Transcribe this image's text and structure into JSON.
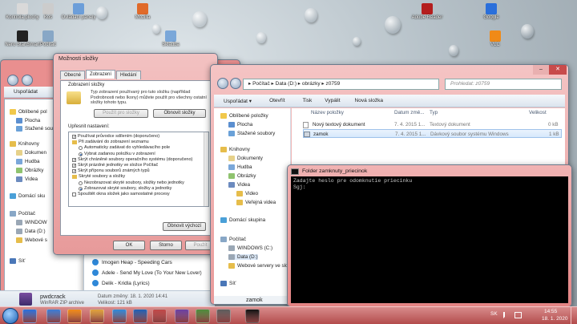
{
  "desktop": {
    "icons": [
      {
        "label": "Kontrola\nplochy",
        "color": "#d9d9d9"
      },
      {
        "label": "Koš",
        "color": "#cccccc"
      },
      {
        "label": "Ovládací\npanely",
        "color": "#6c9ed9"
      },
      {
        "label": "Mozilla",
        "color": "#e06a2a"
      },
      {
        "label": "Adobe Reader",
        "color": "#b41e1e"
      },
      {
        "label": "Google",
        "color": "#2a6fdb"
      },
      {
        "label": "Nero\nStartSmart",
        "color": "#222222"
      },
      {
        "label": "Počítač",
        "color": "#88a7c6"
      },
      {
        "label": "Skladba",
        "color": "#7aa7d9"
      },
      {
        "label": "VLC",
        "color": "#f08a17"
      }
    ]
  },
  "left_explorer": {
    "organize_label": "Uspořádat",
    "nav": {
      "favorites": "Oblíbené pol",
      "desktop": "Plocha",
      "downloads": "Stažené sou",
      "libraries": "Knihovny",
      "documents": "Dokumen",
      "music": "Hudba",
      "pictures": "Obrázky",
      "videos": "Videa",
      "homegroup": "Domácí sku",
      "computer": "Počítač",
      "windows": "WINDOW",
      "data": "Data (D:)",
      "web": "Webové s",
      "network": "Síť"
    },
    "details": {
      "name": "pwdcrack",
      "type": "WinRAR ZIP archive",
      "modified": "Datum změny: 18. 1. 2020 14:41",
      "size": "Velikost: 121 kB"
    }
  },
  "media_list": {
    "items": [
      "Imogen Heap - Speeding Cars",
      "Adele - Send My Love (To Your New Lover)",
      "Delik - Kridla (Lyrics)"
    ]
  },
  "folder_options": {
    "title": "Možnosti složky",
    "tabs": [
      "Obecné",
      "Zobrazení",
      "Hledání"
    ],
    "group1_label": "Zobrazení složky",
    "group1_desc": "Typ zobrazení používaný pro tuto složku (například Podrobnosti nebo Ikony) můžete použít pro všechny ostatní složky tohoto typu.",
    "apply_folders": "Použít pro složky",
    "reset_folders": "Obnovit složky",
    "advanced_label": "Upřesnit nastavení:",
    "settings": [
      {
        "kind": "cb",
        "checked": true,
        "text": "Používat průvodce sdílením (doporučeno)",
        "indent": 0
      },
      {
        "kind": "fold",
        "checked": false,
        "text": "Při zadávání do zobrazení seznamu",
        "indent": 0
      },
      {
        "kind": "rb",
        "checked": false,
        "text": "Automaticky zadávat do vyhledávacího pole",
        "indent": 1
      },
      {
        "kind": "rb",
        "checked": true,
        "text": "Vybrat zadanou položku v zobrazení",
        "indent": 1
      },
      {
        "kind": "cb",
        "checked": true,
        "text": "Skrýt chráněné soubory operačního systému (doporučeno)",
        "indent": 0
      },
      {
        "kind": "cb",
        "checked": true,
        "text": "Skrýt prázdné jednotky ve složce Počítač",
        "indent": 0
      },
      {
        "kind": "cb",
        "checked": true,
        "text": "Skrýt příponu souborů známých typů",
        "indent": 0
      },
      {
        "kind": "fold",
        "checked": false,
        "text": "Skryté soubory a složky",
        "indent": 0
      },
      {
        "kind": "rb",
        "checked": false,
        "text": "Nezobrazovat skryté soubory, složky nebo jednotky",
        "indent": 1
      },
      {
        "kind": "rb",
        "checked": true,
        "text": "Zobrazovat skryté soubory, složky a jednotky",
        "indent": 1
      },
      {
        "kind": "cb",
        "checked": false,
        "text": "Spouštět okna složek jako samostatné procesy",
        "indent": 0
      }
    ],
    "restore_defaults": "Obnovit výchozí",
    "ok": "OK",
    "cancel": "Storno",
    "apply": "Použít"
  },
  "main_explorer": {
    "address": "▸ Počítač ▸ Data (D:) ▸ obrázky ▸ z0759",
    "search_placeholder": "Prohledat: z0759",
    "toolbar": [
      "Uspořádat ▾",
      "Otevřít",
      "Tisk",
      "Vypálit",
      "Nová složka"
    ],
    "nav": {
      "favorites": "Oblíbené položky",
      "desktop": "Plocha",
      "downloads": "Stažené soubory",
      "libraries": "Knihovny",
      "documents": "Dokumenty",
      "music": "Hudba",
      "pictures": "Obrázky",
      "videos": "Videa",
      "videos_sub": "Video",
      "public_videos": "Veřejná videa",
      "homegroup": "Domácí skupina",
      "computer": "Počítač",
      "windows": "WINDOWS (C:)",
      "data": "Data (D:)",
      "web": "Webové servery ve slož",
      "network": "Síť"
    },
    "columns": {
      "name": "Název položky",
      "date": "Datum změ...",
      "type": "Typ",
      "size": "Velikost"
    },
    "files": [
      {
        "name": "Nový textový dokument",
        "date": "7. 4. 2015 1...",
        "type": "Textový dokument",
        "size": "0 kB",
        "selected": false
      },
      {
        "name": "zamok",
        "date": "7. 4. 2015 1...",
        "type": "Dávkový soubor systému Windows",
        "size": "1 kB",
        "selected": true
      }
    ],
    "details_name": "zamok"
  },
  "console": {
    "title": "Folder zamknuty_priecinok",
    "line1": "Zadajte heslo pre odomknutie priecinku",
    "line2": "Sgj:"
  },
  "taskbar": {
    "lang": "SK",
    "time": "14:55",
    "date": "18. 1. 2020",
    "apps": [
      "#2a6fdb",
      "#3a7bd5",
      "#f08a17",
      "#e0a23a",
      "#2f88d8",
      "#1f5fb4",
      "#c04646",
      "#6a3fa3",
      "#4c8c3a",
      "#5c5c5c",
      "#111111"
    ]
  }
}
